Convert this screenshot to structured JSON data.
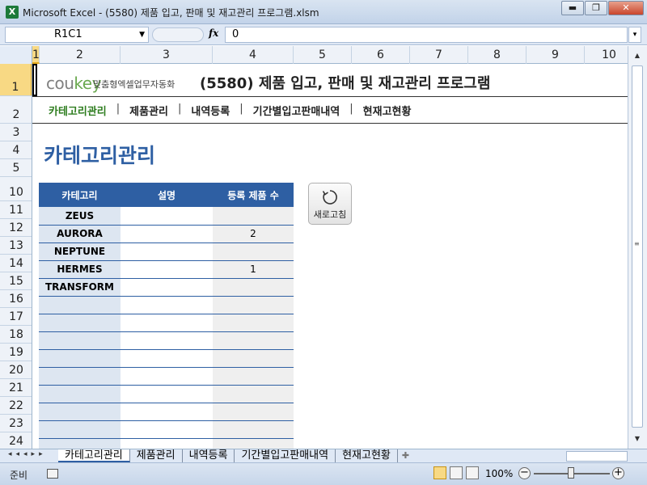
{
  "window": {
    "title": "Microsoft Excel - (5580) 제품 입고, 판매 및 재고관리 프로그램.xlsm",
    "app_icon": "X",
    "minimize": "▬",
    "restore": "❐",
    "close": "✕"
  },
  "formula_bar": {
    "name_box": "R1C1",
    "fx_label": "fx",
    "formula": "0"
  },
  "columns": [
    "1",
    "2",
    "3",
    "4",
    "5",
    "6",
    "7",
    "8",
    "9",
    "10"
  ],
  "rows": [
    "1",
    "2",
    "3",
    "4",
    "5",
    "10",
    "11",
    "12",
    "13",
    "14",
    "15",
    "16",
    "17",
    "18",
    "19",
    "20",
    "21",
    "22",
    "23",
    "24"
  ],
  "header": {
    "brand_main": "cou",
    "brand_accent": "key",
    "brand_subtitle": "맞춤형엑셀업무자동화",
    "app_title": "(5580) 제품 입고, 판매 및 재고관리 프로그램"
  },
  "nav": {
    "items": [
      "카테고리관리",
      "제품관리",
      "내역등록",
      "기간별입고판매내역",
      "현재고현황"
    ],
    "separator": "|",
    "active": 0
  },
  "page": {
    "heading": "카테고리관리"
  },
  "category_table": {
    "headers": [
      "카테고리",
      "설명",
      "등록 제품 수"
    ],
    "rows": [
      [
        "ZEUS",
        "",
        ""
      ],
      [
        "AURORA",
        "",
        "2"
      ],
      [
        "NEPTUNE",
        "",
        ""
      ],
      [
        "HERMES",
        "",
        "1"
      ],
      [
        "TRANSFORM",
        "",
        ""
      ],
      [
        "",
        "",
        ""
      ],
      [
        "",
        "",
        ""
      ],
      [
        "",
        "",
        ""
      ],
      [
        "",
        "",
        ""
      ],
      [
        "",
        "",
        ""
      ],
      [
        "",
        "",
        ""
      ],
      [
        "",
        "",
        ""
      ],
      [
        "",
        "",
        ""
      ],
      [
        "",
        "",
        ""
      ]
    ]
  },
  "refresh_button": {
    "label": "새로고침",
    "icon": "refresh-icon"
  },
  "sheet_tabs": {
    "tabs": [
      "카테고리관리",
      "제품관리",
      "내역등록",
      "기간별입고판매내역",
      "현재고현황"
    ],
    "active": 0,
    "nav_arrows": "◂◂◂▸▸"
  },
  "status_bar": {
    "status": "준비",
    "zoom": "100%",
    "zoom_minus": "−",
    "zoom_plus": "+"
  },
  "colors": {
    "accent_blue": "#2e5fa3",
    "nav_active_green": "#2e7d1f",
    "brand_green": "#6aa84f",
    "selection_yellow": "#f8d984"
  }
}
